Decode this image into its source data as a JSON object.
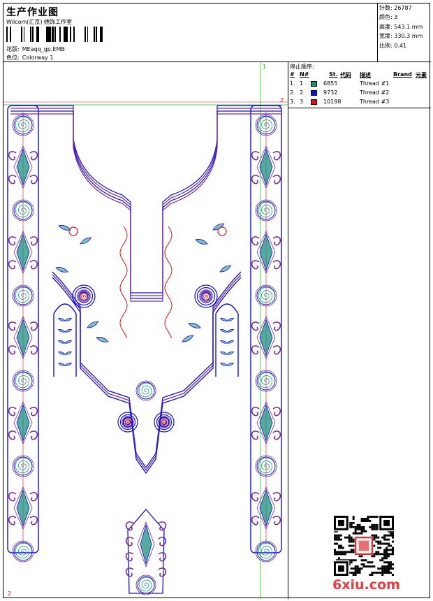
{
  "header": {
    "title": "生产作业图",
    "company": "Wilcom(汇京) 绣饰工作室",
    "design_label": "花版:",
    "design_value": "MEaqq_gp.EMB",
    "colorway_label": "色位:",
    "colorway_value": "Colorway 1"
  },
  "stats": [
    {
      "label": "针数:",
      "value": "26787"
    },
    {
      "label": "颜色:",
      "value": "3"
    },
    {
      "label": "高度:",
      "value": "543.1 mm"
    },
    {
      "label": "宽度:",
      "value": "330.3 mm"
    },
    {
      "label": "比例:",
      "value": "0.41"
    }
  ],
  "sequence": {
    "title": "停止顺序:",
    "columns": [
      "#",
      "N#",
      "St.",
      "代码",
      "描述",
      "Brand",
      "元素"
    ],
    "rows": [
      {
        "idx": "1.",
        "n": "1",
        "color": "#1b8f80",
        "code": "6855",
        "desc": "Thread #1"
      },
      {
        "idx": "2.",
        "n": "2",
        "color": "#1010e0",
        "code": "9732",
        "desc": "Thread #2"
      },
      {
        "idx": "3.",
        "n": "3",
        "color": "#e01010",
        "code": "10198",
        "desc": "Thread #3"
      }
    ]
  },
  "axes": {
    "x_start": "1",
    "y_start": "2",
    "marker_right": "2"
  },
  "thread_colors": {
    "teal": "#1b8f80",
    "blue": "#1010e0",
    "red": "#e01010",
    "purple": "#7a2a9a",
    "grid": "#22c022"
  },
  "watermark": "6xiu.com"
}
